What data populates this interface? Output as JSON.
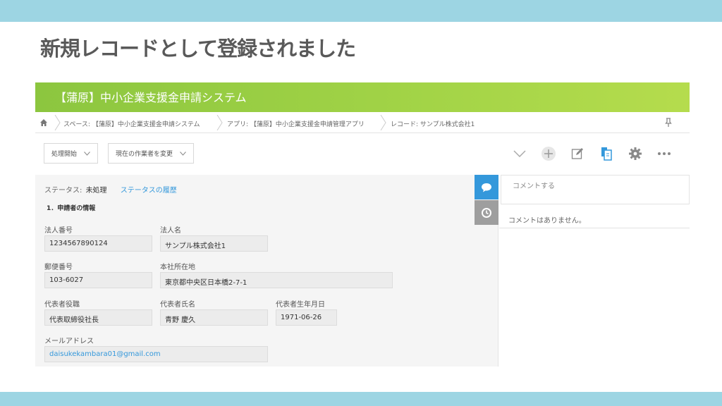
{
  "slide": {
    "title": "新規レコードとして登録されました"
  },
  "app": {
    "header_title": "【蒲原】中小企業支援金申請システム",
    "breadcrumb": {
      "space": "スペース: 【蒲原】中小企業支援金申請システム",
      "app": "アプリ: 【蒲原】中小企業支援金申請管理アプリ",
      "record": "レコード: サンプル株式会社1"
    },
    "toolbar": {
      "process_start": "処理開始",
      "change_assignee": "現在の作業者を変更"
    },
    "status": {
      "label": "ステータス:",
      "value": "未処理",
      "history_link": "ステータスの履歴"
    },
    "section_title": "1．申請者の情報",
    "fields": {
      "corp_number": {
        "label": "法人番号",
        "value": "1234567890124"
      },
      "corp_name": {
        "label": "法人名",
        "value": "サンプル株式会社1"
      },
      "postal_code": {
        "label": "郵便番号",
        "value": "103-6027"
      },
      "address": {
        "label": "本社所在地",
        "value": "東京都中央区日本橋2-7-1"
      },
      "rep_title": {
        "label": "代表者役職",
        "value": "代表取締役社長"
      },
      "rep_name": {
        "label": "代表者氏名",
        "value": "青野 慶久"
      },
      "rep_birthdate": {
        "label": "代表者生年月日",
        "value": "1971-06-26"
      },
      "email": {
        "label": "メールアドレス",
        "value": "daisukekambara01@gmail.com"
      }
    },
    "comments": {
      "input_placeholder": "コメントする",
      "empty_message": "コメントはありません。"
    }
  },
  "colors": {
    "band": "#9dd5e3",
    "header_green": "#8cc63f",
    "accent_blue": "#3498db"
  },
  "icons": [
    "home-icon",
    "pin-icon",
    "chevron-down-icon",
    "plus-icon",
    "edit-icon",
    "copy-icon",
    "gear-icon",
    "more-icon",
    "comment-icon",
    "history-icon"
  ]
}
